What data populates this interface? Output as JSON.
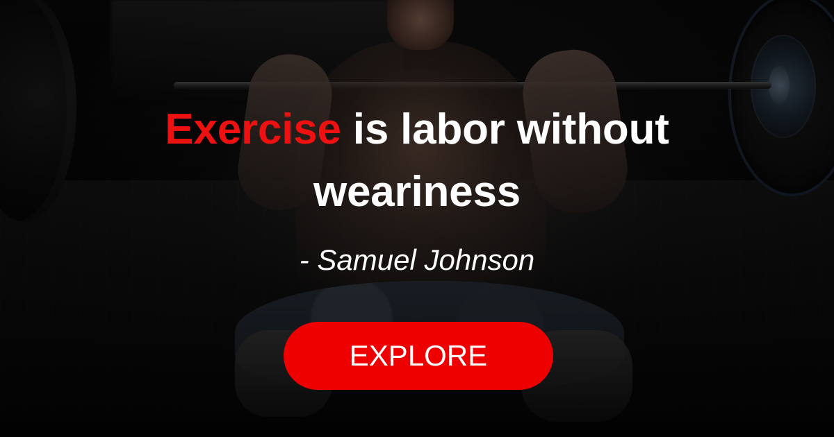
{
  "hero": {
    "quote_highlight": "Exercise",
    "quote_line_1": " is labor without",
    "quote_line_2": "weariness",
    "author": "- Samuel Johnson",
    "button_label": "EXPLORE"
  },
  "colors": {
    "accent": "#ee0000",
    "text": "#ffffff",
    "background": "#050505"
  },
  "image": {
    "semantic_icons": [
      "barbell-icon",
      "weight-plate-icon"
    ]
  }
}
